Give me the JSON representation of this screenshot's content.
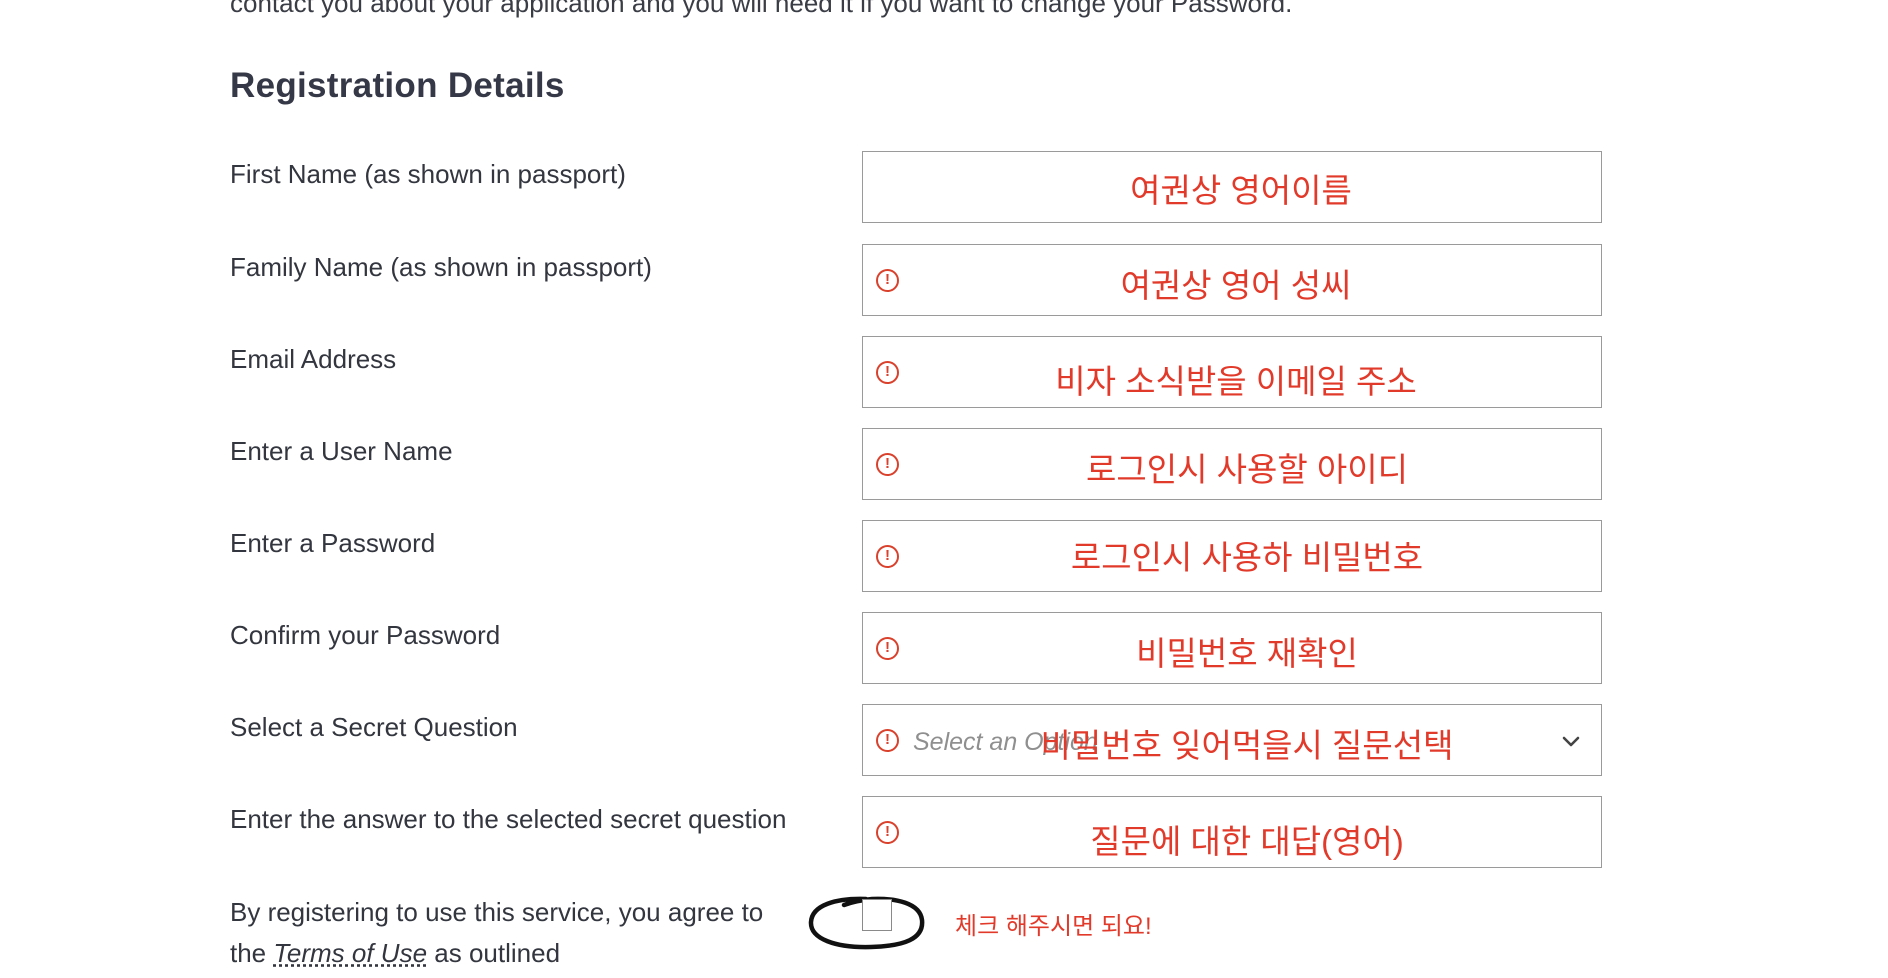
{
  "page": {
    "top_cut_text": "contact you about your application and you will need it if you want to change your Password.",
    "section_title": "Registration Details"
  },
  "fields": [
    {
      "label": "First Name (as shown in passport)",
      "annotation": "여권상 영어이름",
      "error": false
    },
    {
      "label": "Family Name (as shown in passport)",
      "annotation": "여권상 영어 성씨",
      "error": true
    },
    {
      "label": "Email Address",
      "annotation": "비자 소식받을 이메일 주소",
      "error": true
    },
    {
      "label": "Enter a User Name",
      "annotation": "로그인시 사용할 아이디",
      "error": true
    },
    {
      "label": "Enter a Password",
      "annotation": "로그인시 사용하 비밀번호",
      "error": true
    },
    {
      "label": "Confirm your Password",
      "annotation": "비밀번호 재확인",
      "error": true
    },
    {
      "label": "Select a Secret Question",
      "annotation": "비밀번호 잊어먹을시 질문선택",
      "error": true,
      "placeholder": "Select an Option"
    },
    {
      "label": "Enter the answer to the selected secret question",
      "annotation": "질문에 대한 대답(영어)",
      "error": true
    }
  ],
  "terms": {
    "prefix": "By registering to use this service, you agree to the",
    "link": "Terms of Use",
    "suffix": "as outlined",
    "checked": false,
    "annotation": "체크 해주시면 되요!"
  },
  "icons": {
    "error": "exclamation-circle-icon",
    "dropdown": "chevron-down-icon"
  },
  "colors": {
    "error": "#d9412c",
    "annotation": "#e23a2a",
    "title": "#353846"
  }
}
